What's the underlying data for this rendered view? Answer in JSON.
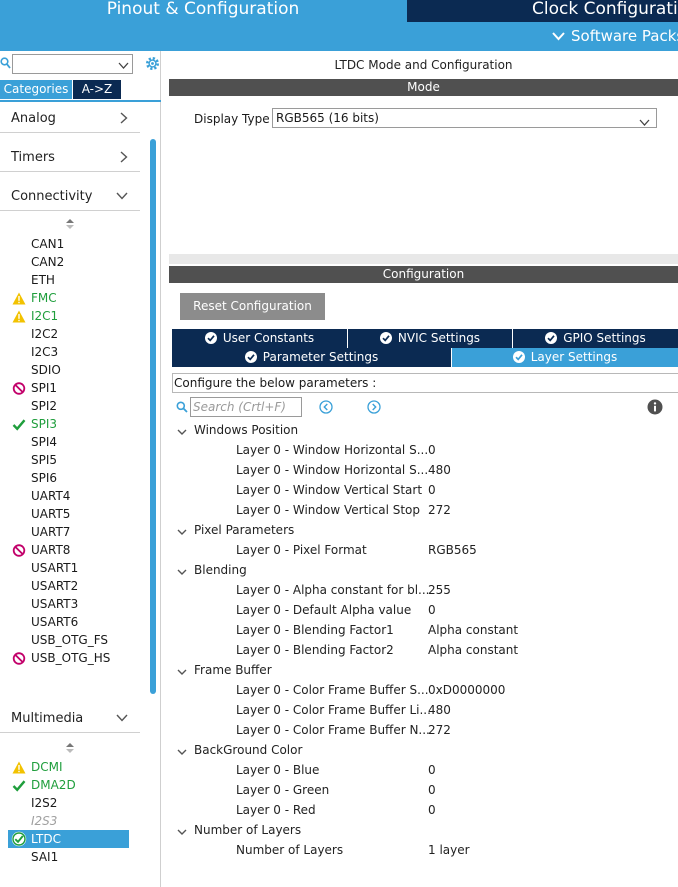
{
  "tabs": {
    "pinout": "Pinout & Configuration",
    "clock": "Clock Configuration",
    "software_packs": "Software Packs"
  },
  "left": {
    "search": {
      "value": ""
    },
    "view_tabs": [
      "Categories",
      "A->Z"
    ],
    "categories": [
      {
        "label": "Analog",
        "expanded": false
      },
      {
        "label": "Timers",
        "expanded": false
      },
      {
        "label": "Connectivity",
        "expanded": true
      },
      {
        "label": "Multimedia",
        "expanded": true
      }
    ],
    "connectivity_items": [
      {
        "label": "CAN1",
        "status": "none"
      },
      {
        "label": "CAN2",
        "status": "none"
      },
      {
        "label": "ETH",
        "status": "none"
      },
      {
        "label": "FMC",
        "status": "warning"
      },
      {
        "label": "I2C1",
        "status": "warning"
      },
      {
        "label": "I2C2",
        "status": "none"
      },
      {
        "label": "I2C3",
        "status": "none"
      },
      {
        "label": "SDIO",
        "status": "none"
      },
      {
        "label": "SPI1",
        "status": "error"
      },
      {
        "label": "SPI2",
        "status": "none"
      },
      {
        "label": "SPI3",
        "status": "ok"
      },
      {
        "label": "SPI4",
        "status": "none"
      },
      {
        "label": "SPI5",
        "status": "none"
      },
      {
        "label": "SPI6",
        "status": "none"
      },
      {
        "label": "UART4",
        "status": "none"
      },
      {
        "label": "UART5",
        "status": "none"
      },
      {
        "label": "UART7",
        "status": "none"
      },
      {
        "label": "UART8",
        "status": "error"
      },
      {
        "label": "USART1",
        "status": "none"
      },
      {
        "label": "USART2",
        "status": "none"
      },
      {
        "label": "USART3",
        "status": "none"
      },
      {
        "label": "USART6",
        "status": "none"
      },
      {
        "label": "USB_OTG_FS",
        "status": "none"
      },
      {
        "label": "USB_OTG_HS",
        "status": "error"
      }
    ],
    "multimedia_items": [
      {
        "label": "DCMI",
        "status": "warning"
      },
      {
        "label": "DMA2D",
        "status": "ok"
      },
      {
        "label": "I2S2",
        "status": "none"
      },
      {
        "label": "I2S3",
        "status": "disabled"
      },
      {
        "label": "LTDC",
        "status": "selected"
      },
      {
        "label": "SAI1",
        "status": "none"
      }
    ]
  },
  "right": {
    "title": "LTDC Mode and Configuration",
    "mode_header": "Mode",
    "display_type_label": "Display Type",
    "display_type_value": "RGB565 (16 bits)",
    "config_header": "Configuration",
    "reset_label": "Reset Configuration",
    "tabs_row1": [
      "User Constants",
      "NVIC Settings",
      "GPIO Settings"
    ],
    "tabs_row2": [
      "Parameter Settings",
      "Layer Settings"
    ],
    "active_tab": "Layer Settings",
    "configure_label": "Configure the below parameters :",
    "search_placeholder": "Search (Crtl+F)",
    "groups": [
      {
        "name": "Windows Position",
        "params": [
          {
            "name": "Layer 0 - Window Horizontal S...",
            "value": "0"
          },
          {
            "name": "Layer 0 - Window Horizontal S...",
            "value": "480"
          },
          {
            "name": "Layer 0 - Window Vertical Start",
            "value": "0"
          },
          {
            "name": "Layer 0 - Window Vertical Stop",
            "value": "272"
          }
        ]
      },
      {
        "name": "Pixel Parameters",
        "params": [
          {
            "name": "Layer 0 - Pixel Format",
            "value": "RGB565"
          }
        ]
      },
      {
        "name": "Blending",
        "params": [
          {
            "name": "Layer 0 - Alpha constant for bl...",
            "value": "255"
          },
          {
            "name": "Layer 0 - Default Alpha value",
            "value": "0"
          },
          {
            "name": "Layer 0 - Blending Factor1",
            "value": "Alpha constant"
          },
          {
            "name": "Layer 0 - Blending Factor2",
            "value": "Alpha constant"
          }
        ]
      },
      {
        "name": "Frame Buffer",
        "params": [
          {
            "name": "Layer 0 - Color Frame Buffer S...",
            "value": "0xD0000000"
          },
          {
            "name": "Layer 0 - Color Frame Buffer Li...",
            "value": "480"
          },
          {
            "name": "Layer 0 - Color Frame Buffer N...",
            "value": "272"
          }
        ]
      },
      {
        "name": "BackGround Color",
        "params": [
          {
            "name": "Layer 0 - Blue",
            "value": "0"
          },
          {
            "name": "Layer 0 - Green",
            "value": "0"
          },
          {
            "name": "Layer 0 - Red",
            "value": "0"
          }
        ]
      },
      {
        "name": "Number of Layers",
        "params": [
          {
            "name": "Number of Layers",
            "value": "1 layer"
          }
        ]
      }
    ]
  },
  "colors": {
    "accent": "#3aa0d8",
    "dark_tab": "#0b2a52",
    "ok": "#1f9e3c",
    "warning": "#f2c200",
    "error": "#c2006a"
  }
}
